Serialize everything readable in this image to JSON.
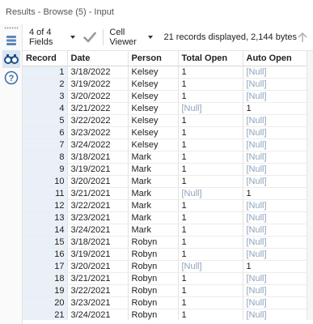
{
  "window": {
    "title": "Results - Browse (5) - Input"
  },
  "toolbar": {
    "fields_label": "4 of 4 Fields",
    "viewer_label": "Cell Viewer",
    "status_text": "21 records displayed, 2,144 bytes"
  },
  "icons": {
    "grip": "grip-dots-icon",
    "table_view": "table-view-icon",
    "binoculars": "binoculars-icon",
    "help": "question-circle-icon",
    "check": "checkmark-icon",
    "caret": "chevron-down-icon",
    "up": "arrow-up-icon"
  },
  "colors": {
    "null_text": "#8fa3bc",
    "record_column_bg": "#eaf0f7",
    "active_tool_bg": "#dbe6f2"
  },
  "table": {
    "columns": [
      "Record",
      "Date",
      "Person",
      "Total Open",
      "Auto Open"
    ],
    "rows": [
      [
        "1",
        "3/18/2022",
        "Kelsey",
        "1",
        "[Null]"
      ],
      [
        "2",
        "3/19/2022",
        "Kelsey",
        "1",
        "[Null]"
      ],
      [
        "3",
        "3/20/2022",
        "Kelsey",
        "1",
        "[Null]"
      ],
      [
        "4",
        "3/21/2022",
        "Kelsey",
        "[Null]",
        "1"
      ],
      [
        "5",
        "3/22/2022",
        "Kelsey",
        "1",
        "[Null]"
      ],
      [
        "6",
        "3/23/2022",
        "Kelsey",
        "1",
        "[Null]"
      ],
      [
        "7",
        "3/24/2022",
        "Kelsey",
        "1",
        "[Null]"
      ],
      [
        "8",
        "3/18/2021",
        "Mark",
        "1",
        "[Null]"
      ],
      [
        "9",
        "3/19/2021",
        "Mark",
        "1",
        "[Null]"
      ],
      [
        "10",
        "3/20/2021",
        "Mark",
        "1",
        "[Null]"
      ],
      [
        "11",
        "3/21/2021",
        "Mark",
        "[Null]",
        "1"
      ],
      [
        "12",
        "3/22/2021",
        "Mark",
        "1",
        "[Null]"
      ],
      [
        "13",
        "3/23/2021",
        "Mark",
        "1",
        "[Null]"
      ],
      [
        "14",
        "3/24/2021",
        "Mark",
        "1",
        "[Null]"
      ],
      [
        "15",
        "3/18/2021",
        "Robyn",
        "1",
        "[Null]"
      ],
      [
        "16",
        "3/19/2021",
        "Robyn",
        "1",
        "[Null]"
      ],
      [
        "17",
        "3/20/2021",
        "Robyn",
        "[Null]",
        "1"
      ],
      [
        "18",
        "3/21/2021",
        "Robyn",
        "1",
        "[Null]"
      ],
      [
        "19",
        "3/22/2021",
        "Robyn",
        "1",
        "[Null]"
      ],
      [
        "20",
        "3/23/2021",
        "Robyn",
        "1",
        "[Null]"
      ],
      [
        "21",
        "3/24/2021",
        "Robyn",
        "1",
        "[Null]"
      ]
    ]
  }
}
